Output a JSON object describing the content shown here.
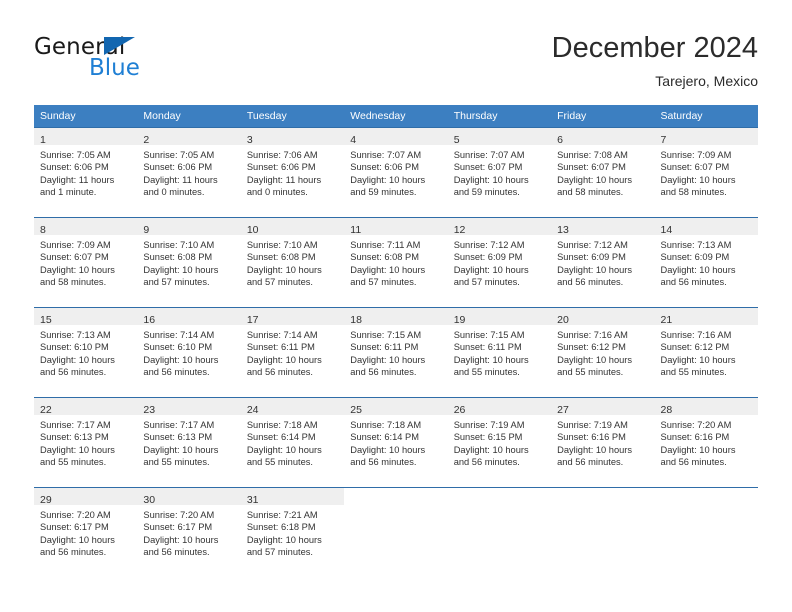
{
  "brand": {
    "name_part1": "General",
    "name_part2": "Blue",
    "triangle_color": "#1266b0",
    "blue_color": "#1f7fd4"
  },
  "header": {
    "title": "December 2024",
    "subtitle": "Tarejero, Mexico"
  },
  "theme": {
    "header_bg": "#3c7fc1",
    "row_separator": "#2f6da8",
    "daynum_band_bg": "#efefef",
    "text": "#333333"
  },
  "weekday_headers": [
    "Sunday",
    "Monday",
    "Tuesday",
    "Wednesday",
    "Thursday",
    "Friday",
    "Saturday"
  ],
  "weeks": [
    [
      {
        "day": "1",
        "sunrise": "Sunrise: 7:05 AM",
        "sunset": "Sunset: 6:06 PM",
        "daylight1": "Daylight: 11 hours",
        "daylight2": "and 1 minute."
      },
      {
        "day": "2",
        "sunrise": "Sunrise: 7:05 AM",
        "sunset": "Sunset: 6:06 PM",
        "daylight1": "Daylight: 11 hours",
        "daylight2": "and 0 minutes."
      },
      {
        "day": "3",
        "sunrise": "Sunrise: 7:06 AM",
        "sunset": "Sunset: 6:06 PM",
        "daylight1": "Daylight: 11 hours",
        "daylight2": "and 0 minutes."
      },
      {
        "day": "4",
        "sunrise": "Sunrise: 7:07 AM",
        "sunset": "Sunset: 6:06 PM",
        "daylight1": "Daylight: 10 hours",
        "daylight2": "and 59 minutes."
      },
      {
        "day": "5",
        "sunrise": "Sunrise: 7:07 AM",
        "sunset": "Sunset: 6:07 PM",
        "daylight1": "Daylight: 10 hours",
        "daylight2": "and 59 minutes."
      },
      {
        "day": "6",
        "sunrise": "Sunrise: 7:08 AM",
        "sunset": "Sunset: 6:07 PM",
        "daylight1": "Daylight: 10 hours",
        "daylight2": "and 58 minutes."
      },
      {
        "day": "7",
        "sunrise": "Sunrise: 7:09 AM",
        "sunset": "Sunset: 6:07 PM",
        "daylight1": "Daylight: 10 hours",
        "daylight2": "and 58 minutes."
      }
    ],
    [
      {
        "day": "8",
        "sunrise": "Sunrise: 7:09 AM",
        "sunset": "Sunset: 6:07 PM",
        "daylight1": "Daylight: 10 hours",
        "daylight2": "and 58 minutes."
      },
      {
        "day": "9",
        "sunrise": "Sunrise: 7:10 AM",
        "sunset": "Sunset: 6:08 PM",
        "daylight1": "Daylight: 10 hours",
        "daylight2": "and 57 minutes."
      },
      {
        "day": "10",
        "sunrise": "Sunrise: 7:10 AM",
        "sunset": "Sunset: 6:08 PM",
        "daylight1": "Daylight: 10 hours",
        "daylight2": "and 57 minutes."
      },
      {
        "day": "11",
        "sunrise": "Sunrise: 7:11 AM",
        "sunset": "Sunset: 6:08 PM",
        "daylight1": "Daylight: 10 hours",
        "daylight2": "and 57 minutes."
      },
      {
        "day": "12",
        "sunrise": "Sunrise: 7:12 AM",
        "sunset": "Sunset: 6:09 PM",
        "daylight1": "Daylight: 10 hours",
        "daylight2": "and 57 minutes."
      },
      {
        "day": "13",
        "sunrise": "Sunrise: 7:12 AM",
        "sunset": "Sunset: 6:09 PM",
        "daylight1": "Daylight: 10 hours",
        "daylight2": "and 56 minutes."
      },
      {
        "day": "14",
        "sunrise": "Sunrise: 7:13 AM",
        "sunset": "Sunset: 6:09 PM",
        "daylight1": "Daylight: 10 hours",
        "daylight2": "and 56 minutes."
      }
    ],
    [
      {
        "day": "15",
        "sunrise": "Sunrise: 7:13 AM",
        "sunset": "Sunset: 6:10 PM",
        "daylight1": "Daylight: 10 hours",
        "daylight2": "and 56 minutes."
      },
      {
        "day": "16",
        "sunrise": "Sunrise: 7:14 AM",
        "sunset": "Sunset: 6:10 PM",
        "daylight1": "Daylight: 10 hours",
        "daylight2": "and 56 minutes."
      },
      {
        "day": "17",
        "sunrise": "Sunrise: 7:14 AM",
        "sunset": "Sunset: 6:11 PM",
        "daylight1": "Daylight: 10 hours",
        "daylight2": "and 56 minutes."
      },
      {
        "day": "18",
        "sunrise": "Sunrise: 7:15 AM",
        "sunset": "Sunset: 6:11 PM",
        "daylight1": "Daylight: 10 hours",
        "daylight2": "and 56 minutes."
      },
      {
        "day": "19",
        "sunrise": "Sunrise: 7:15 AM",
        "sunset": "Sunset: 6:11 PM",
        "daylight1": "Daylight: 10 hours",
        "daylight2": "and 55 minutes."
      },
      {
        "day": "20",
        "sunrise": "Sunrise: 7:16 AM",
        "sunset": "Sunset: 6:12 PM",
        "daylight1": "Daylight: 10 hours",
        "daylight2": "and 55 minutes."
      },
      {
        "day": "21",
        "sunrise": "Sunrise: 7:16 AM",
        "sunset": "Sunset: 6:12 PM",
        "daylight1": "Daylight: 10 hours",
        "daylight2": "and 55 minutes."
      }
    ],
    [
      {
        "day": "22",
        "sunrise": "Sunrise: 7:17 AM",
        "sunset": "Sunset: 6:13 PM",
        "daylight1": "Daylight: 10 hours",
        "daylight2": "and 55 minutes."
      },
      {
        "day": "23",
        "sunrise": "Sunrise: 7:17 AM",
        "sunset": "Sunset: 6:13 PM",
        "daylight1": "Daylight: 10 hours",
        "daylight2": "and 55 minutes."
      },
      {
        "day": "24",
        "sunrise": "Sunrise: 7:18 AM",
        "sunset": "Sunset: 6:14 PM",
        "daylight1": "Daylight: 10 hours",
        "daylight2": "and 55 minutes."
      },
      {
        "day": "25",
        "sunrise": "Sunrise: 7:18 AM",
        "sunset": "Sunset: 6:14 PM",
        "daylight1": "Daylight: 10 hours",
        "daylight2": "and 56 minutes."
      },
      {
        "day": "26",
        "sunrise": "Sunrise: 7:19 AM",
        "sunset": "Sunset: 6:15 PM",
        "daylight1": "Daylight: 10 hours",
        "daylight2": "and 56 minutes."
      },
      {
        "day": "27",
        "sunrise": "Sunrise: 7:19 AM",
        "sunset": "Sunset: 6:16 PM",
        "daylight1": "Daylight: 10 hours",
        "daylight2": "and 56 minutes."
      },
      {
        "day": "28",
        "sunrise": "Sunrise: 7:20 AM",
        "sunset": "Sunset: 6:16 PM",
        "daylight1": "Daylight: 10 hours",
        "daylight2": "and 56 minutes."
      }
    ],
    [
      {
        "day": "29",
        "sunrise": "Sunrise: 7:20 AM",
        "sunset": "Sunset: 6:17 PM",
        "daylight1": "Daylight: 10 hours",
        "daylight2": "and 56 minutes."
      },
      {
        "day": "30",
        "sunrise": "Sunrise: 7:20 AM",
        "sunset": "Sunset: 6:17 PM",
        "daylight1": "Daylight: 10 hours",
        "daylight2": "and 56 minutes."
      },
      {
        "day": "31",
        "sunrise": "Sunrise: 7:21 AM",
        "sunset": "Sunset: 6:18 PM",
        "daylight1": "Daylight: 10 hours",
        "daylight2": "and 57 minutes."
      },
      {
        "day": "",
        "sunrise": "",
        "sunset": "",
        "daylight1": "",
        "daylight2": ""
      },
      {
        "day": "",
        "sunrise": "",
        "sunset": "",
        "daylight1": "",
        "daylight2": ""
      },
      {
        "day": "",
        "sunrise": "",
        "sunset": "",
        "daylight1": "",
        "daylight2": ""
      },
      {
        "day": "",
        "sunrise": "",
        "sunset": "",
        "daylight1": "",
        "daylight2": ""
      }
    ]
  ]
}
